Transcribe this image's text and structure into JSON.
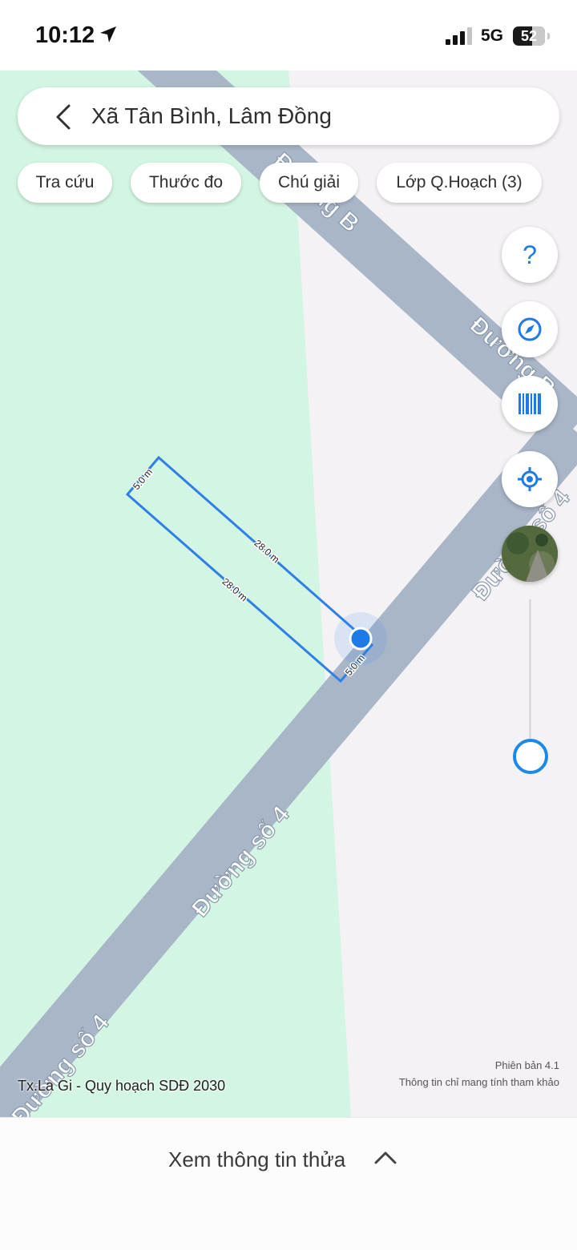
{
  "status_bar": {
    "time": "10:12",
    "network": "5G",
    "battery": "52"
  },
  "search": {
    "location": "Xã Tân Bình, Lâm Đồng"
  },
  "chips": [
    {
      "label": "Tra cứu"
    },
    {
      "label": "Thước đo"
    },
    {
      "label": "Chú giải"
    },
    {
      "label": "Lớp Q.Hoạch (3)"
    }
  ],
  "side_buttons": [
    "help-icon",
    "compass-icon",
    "barcode-icon",
    "locate-icon",
    "satellite-layer-icon"
  ],
  "map": {
    "roads": [
      {
        "label": "Đường số 4"
      },
      {
        "label": "Đường số 4"
      },
      {
        "label": "Đường số 4"
      },
      {
        "label": "Đường B"
      },
      {
        "label": "Đường B"
      }
    ],
    "parcel": {
      "sides": [
        "5.0 m",
        "28.0 m",
        "28.0 m",
        "5.0 m"
      ]
    },
    "colors": {
      "zone_green": "#d3f5e3",
      "zone_white": "#f4f2f4",
      "road": "#a9b6c8",
      "measure": "#2f80e6"
    }
  },
  "footer": {
    "map_name": "Tx.La Gi - Quy hoạch SDĐ 2030",
    "version": "Phiên bản 4.1",
    "disclaimer": "Thông tin chỉ mang tính tham khảo"
  },
  "bottom_panel": {
    "label": "Xem thông tin thửa"
  }
}
